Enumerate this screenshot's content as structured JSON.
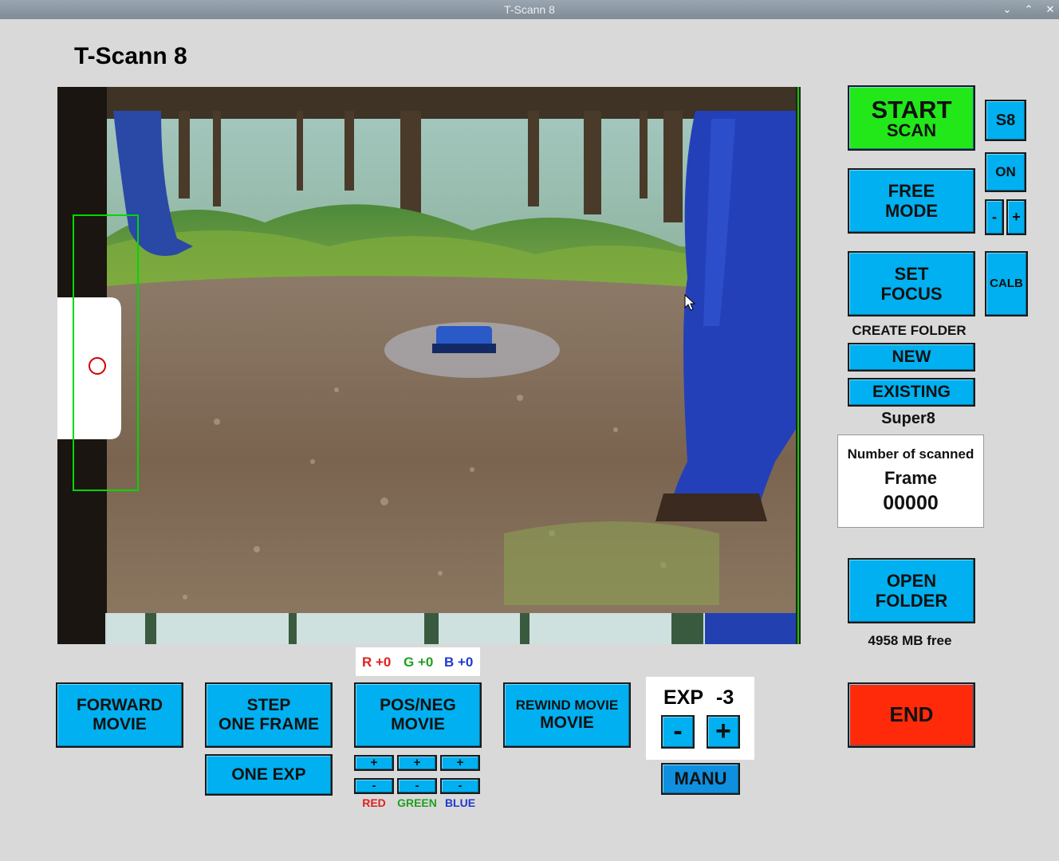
{
  "window": {
    "title": "T-Scann 8",
    "minimize_glyph": "⌄",
    "maximize_glyph": "⌃",
    "close_glyph": "✕"
  },
  "app_title": "T-Scann 8",
  "right_panel": {
    "start_line1": "START",
    "start_line2": "SCAN",
    "s8": "S8",
    "on": "ON",
    "minus": "-",
    "plus": "+",
    "free_line1": "FREE",
    "free_line2": "MODE",
    "set_line1": "SET",
    "set_line2": "FOCUS",
    "calb": "CALB",
    "create_folder": "CREATE FOLDER",
    "new": "NEW",
    "existing": "EXISTING",
    "film_type": "Super8",
    "scanned_label": "Number of scanned",
    "frame_label": "Frame",
    "frame_count": "00000",
    "open_line1": "OPEN",
    "open_line2": "FOLDER",
    "free_space": "4958 MB free",
    "end": "END"
  },
  "bottom": {
    "forward_line1": "FORWARD",
    "forward_line2": "MOVIE",
    "step_line1": "STEP",
    "step_line2": "ONE FRAME",
    "one_exp": "ONE EXP",
    "posneg_line1": "POS/NEG",
    "posneg_line2": "MOVIE",
    "rewind_line1": "REWIND MOVIE",
    "rewind_line2": "MOVIE",
    "rgb": {
      "r": "R +0",
      "g": "G +0",
      "b": "B +0"
    },
    "plus": "+",
    "minus": "-",
    "red": "RED",
    "green": "GREEN",
    "blue": "BLUE",
    "exp_label": "EXP",
    "exp_value": "-3",
    "exp_minus": "-",
    "exp_plus": "+",
    "manu": "MANU"
  },
  "colors": {
    "button": "#00b0f0",
    "start": "#22e81a",
    "end": "#ff2a0a",
    "red": "#e02020",
    "green": "#20a020",
    "blue": "#1f3ad0"
  },
  "icons": [
    "minimize-icon",
    "maximize-icon",
    "close-icon",
    "sprocket-hole-target-icon",
    "mouse-cursor-icon"
  ]
}
